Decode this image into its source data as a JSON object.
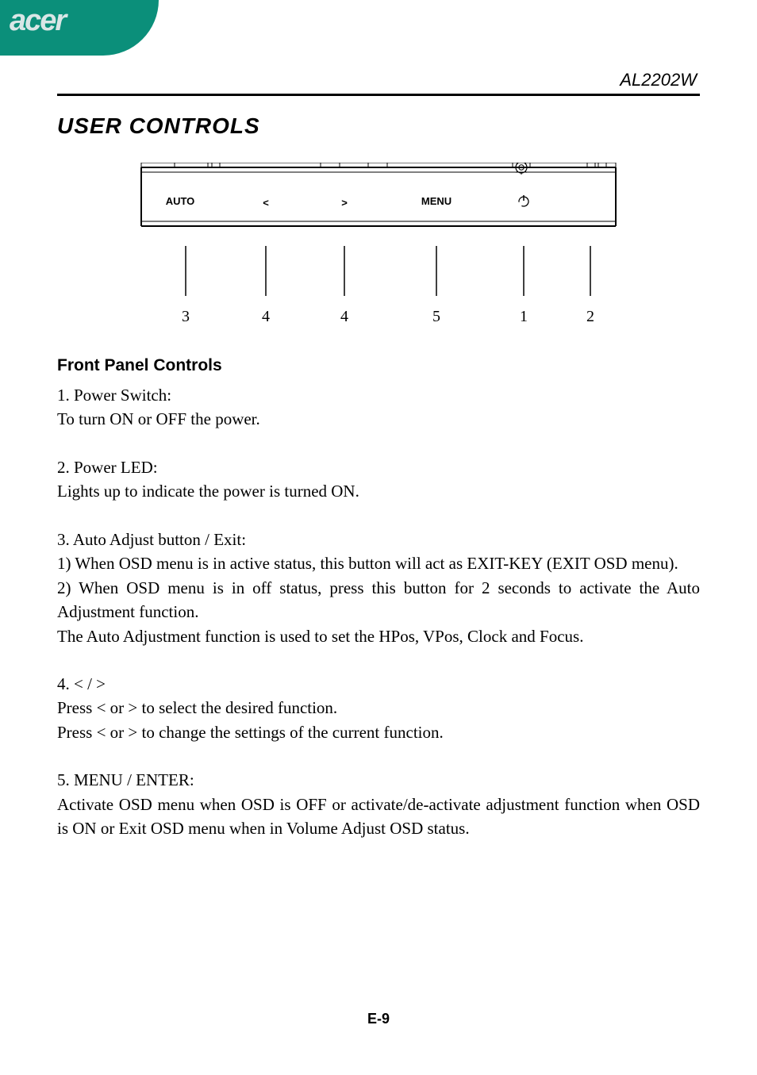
{
  "brand": "acer",
  "model": "AL2202W",
  "title": "USER  CONTROLS",
  "panel": {
    "buttons": {
      "auto": "AUTO",
      "left": "<",
      "right": ">",
      "menu": "MENU"
    },
    "callouts": [
      "3",
      "4",
      "4",
      "5",
      "1",
      "2"
    ]
  },
  "subhead": "Front Panel Controls",
  "sections": [
    {
      "head": "1.  Power Switch:",
      "lines": [
        "To turn ON or OFF the power."
      ]
    },
    {
      "head": "2.  Power LED:",
      "lines": [
        "Lights up to indicate the power is turned ON."
      ]
    },
    {
      "head": "3.  Auto Adjust button / Exit:",
      "lines": [
        "1) When OSD menu is in active status, this button will act as EXIT-KEY (EXIT OSD menu).",
        "2) When OSD menu is in off status, press this button for 2 seconds to activate the Auto Adjustment function.",
        "The Auto Adjustment function is used to set the HPos, VPos, Clock and Focus."
      ]
    },
    {
      "head": "4.  < / >",
      "lines": [
        "Press < or  > to select the desired function.",
        "Press < or  > to change the settings of the current function."
      ]
    },
    {
      "head": "5.  MENU / ENTER:",
      "lines": [
        "Activate OSD menu when OSD is OFF or activate/de-activate adjustment function when OSD is ON or Exit OSD menu when in Volume Adjust OSD status."
      ]
    }
  ],
  "page_number": "E-9"
}
